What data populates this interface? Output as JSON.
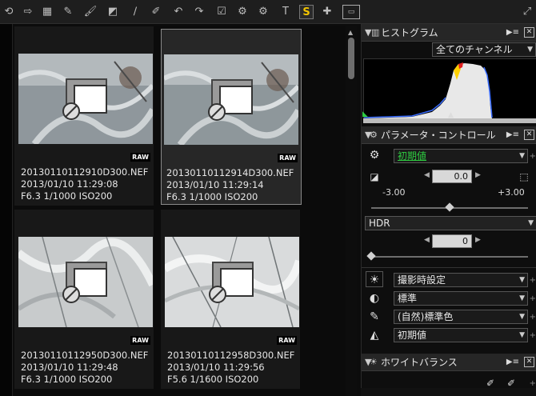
{
  "thumbnails": [
    {
      "filename": "20130110112910D300.NEF",
      "datetime": "2013/01/10 11:29:08",
      "exposure": "F6.3 1/1000 ISO200",
      "badge": "RAW"
    },
    {
      "filename": "20130110112914D300.NEF",
      "datetime": "2013/01/10 11:29:14",
      "exposure": "F6.3 1/1000 ISO200",
      "badge": "RAW"
    },
    {
      "filename": "20130110112950D300.NEF",
      "datetime": "2013/01/10 11:29:48",
      "exposure": "F6.3 1/1000 ISO200",
      "badge": "RAW"
    },
    {
      "filename": "20130110112958D300.NEF",
      "datetime": "2013/01/10 11:29:56",
      "exposure": "F5.6 1/1600 ISO200",
      "badge": "RAW"
    }
  ],
  "histogram": {
    "title": "ヒストグラム",
    "channel": "全てのチャンネル",
    "pin": "▶≡",
    "close": "✕"
  },
  "params": {
    "title": "パラメータ・コントロール",
    "preset": "初期値",
    "exposure_value": "0.0",
    "exposure_min": "-3.00",
    "exposure_max": "+3.00",
    "exposure_level": 0.5,
    "hdr_label": "HDR",
    "hdr_value": "0",
    "hdr_level": 0.0,
    "rows": [
      {
        "icon": "sun-icon",
        "value": "撮影時設定"
      },
      {
        "icon": "contrast-icon",
        "value": "標準"
      },
      {
        "icon": "dropper-icon",
        "value": "(自然)標準色"
      },
      {
        "icon": "tone-icon",
        "value": "初期値"
      }
    ]
  },
  "whitebalance": {
    "title": "ホワイトバランス"
  },
  "colors": {
    "accent_green": "#2ecc40",
    "panel_bg": "#0e0e0e",
    "header_bg": "#262626"
  }
}
